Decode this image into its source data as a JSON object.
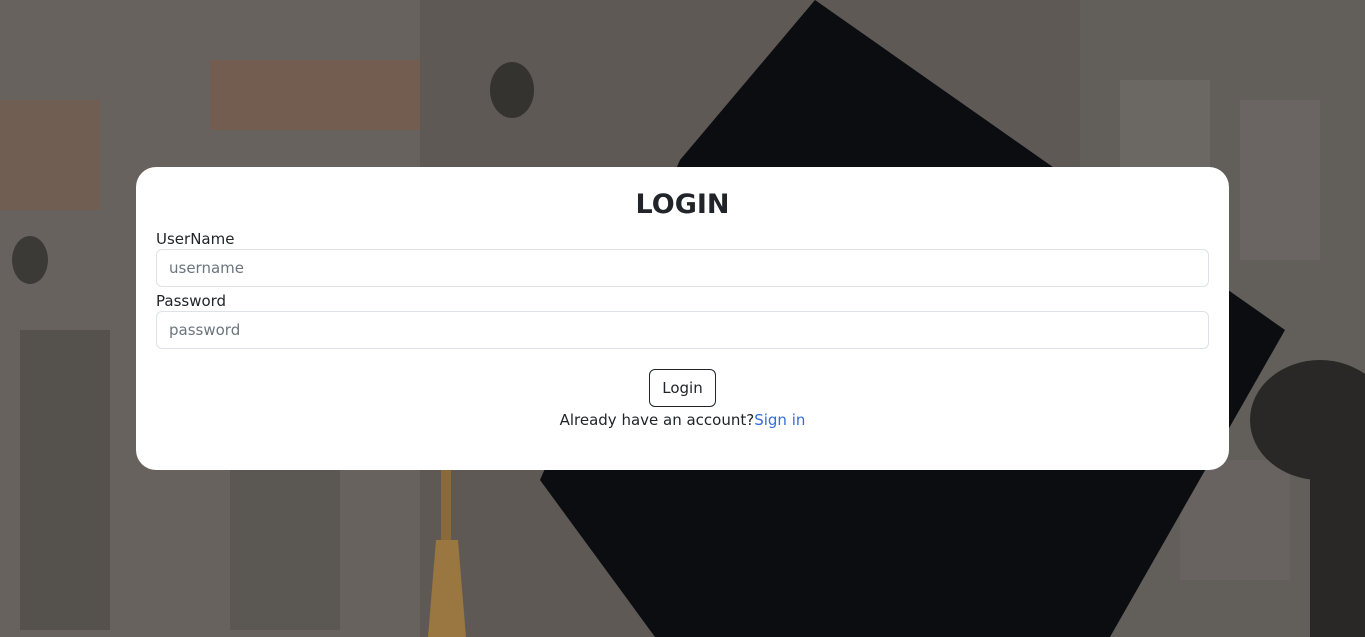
{
  "login": {
    "title": "LOGIN",
    "username_label": "UserName",
    "username_placeholder": "username",
    "username_value": "",
    "password_label": "Password",
    "password_placeholder": "password",
    "password_value": "",
    "login_button": "Login",
    "account_prompt": "Already have an account?",
    "signin_link": "Sign in"
  },
  "colors": {
    "card_background": "#ffffff",
    "link": "#2f6fd6",
    "text": "#212529"
  }
}
